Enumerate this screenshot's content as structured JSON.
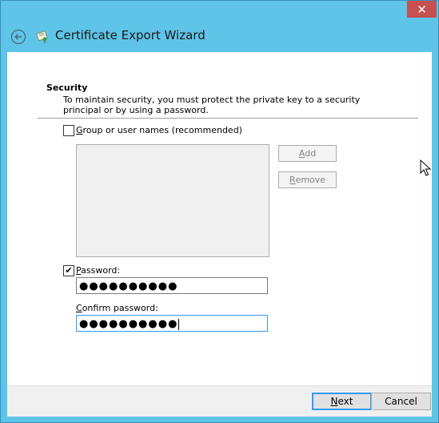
{
  "window": {
    "title": "Certificate Export Wizard",
    "close_glyph": "✕"
  },
  "security": {
    "heading": "Security",
    "description": "To maintain security, you must protect the private key to a security principal or by using a password."
  },
  "group_option": {
    "checked": false,
    "label_underlined": "G",
    "label_rest": "roup or user names (recommended)"
  },
  "group_buttons": {
    "add_label_underlined": "A",
    "add_label_rest": "dd",
    "remove_label_underlined": "R",
    "remove_label_rest": "emove"
  },
  "password_option": {
    "checked": true,
    "check_glyph": "✔",
    "label_underlined": "P",
    "label_rest": "assword:"
  },
  "password_field": {
    "masked_value": "●●●●●●●●●●"
  },
  "confirm_label": {
    "label_underlined": "C",
    "label_rest": "onfirm password:"
  },
  "confirm_field": {
    "masked_value": "●●●●●●●●●●"
  },
  "footer": {
    "next_underlined": "N",
    "next_rest": "ext",
    "cancel_label": "Cancel"
  },
  "colors": {
    "title_bar": "#5ec4e8",
    "close_button": "#c75050",
    "focus_border": "#3399ff"
  },
  "icons": {
    "back": "back-arrow-icon",
    "wizard": "certificate-icon",
    "close": "close-icon",
    "pointer": "mouse-pointer-icon"
  }
}
